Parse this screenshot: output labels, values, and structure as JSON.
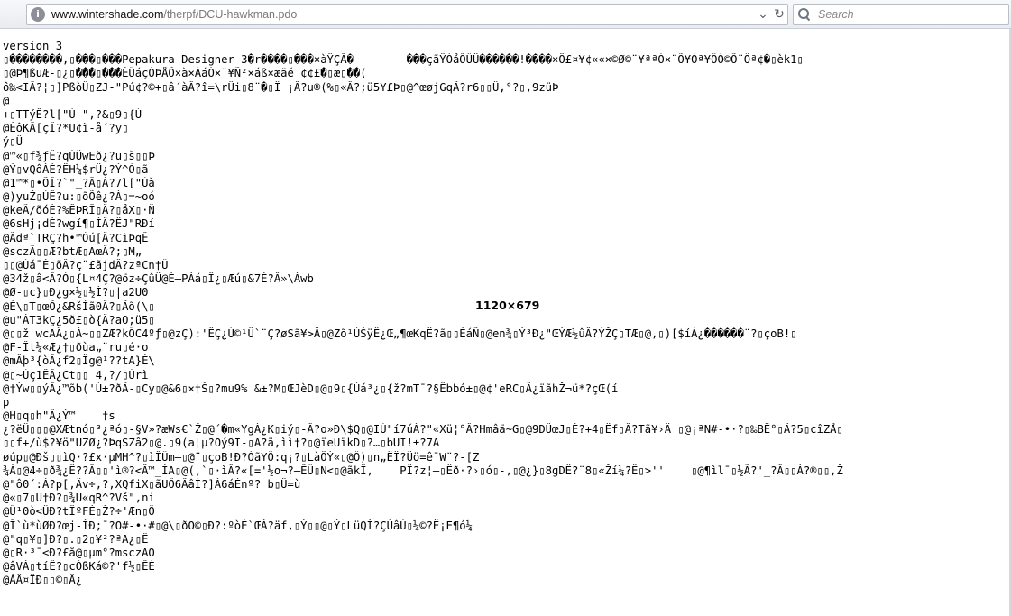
{
  "browser": {
    "url_host": "www.wintershade.com",
    "url_path": "/therpf/DCU-hawkman.pdo",
    "search_placeholder": "Search",
    "icons": {
      "site": "globe-icon",
      "dropdown": "chevron-down-icon",
      "reload": "reload-icon",
      "search": "search-icon"
    }
  },
  "overlay": {
    "dimension_label": "1120×679"
  },
  "document": {
    "lines": [
      "version 3",
      "▯��������,▯���▯���Pepakura Designer 3�r����▯���×àŸÇÂ�        ���çãŸÓåÕÛÜ������!����×Ö£¤¥¢««×©Ø©¨¥ªªÓ×¨Õ¥Óª¥ÔÓ©Õ¨Ôª¢�▯èk1▯",
      "▯@Þ¶ßuÆ-▯¿▯���▯���ÈÛáçÓÞÅÕ×à×ÀáÓ×¨¥Ñ²×áß×æäé ¢¢£�▯æ▯��(",
      "ô‰<IÂ?¦▯]PßòÜ▯ZJ-\"Pú¢?©+▯â´àÂ?î=\\rÜi▯8¨�▯Ï ¡Â?u®(%▯«Â?;ü5Y£Þ▯@^œøjGqÂ?r6▯▯Ü,°?▯,9züÞ",
      "@",
      "+▯TTýÊ?l[\"Ù \",?&▯9▯{Ú",
      "@ÈôKÂ[çÏ?*U¢ì-å´?y▯",
      "ý▯Ü",
      "@™«▯f¾ƒË?qÚÜwEð¿?u▯š▯▯Þ",
      "@Ý▯vQôÀÉ?ËH¼$rÜ¿?Ý^Ò▯ã",
      "@1™*▯•ÕÎ?`\"_?Â▯Á?7l[\"Ùà",
      "@)yuŽ▯ÙÊ?u:▯õÕê¿?Á▯=~oó",
      "@keÃ/õóÈ?%ÊÞRÎ▯Â?▯åX▯·Ñ",
      "@6sHj¡dÈ?wgí¶▯ÍÂ?ËJ\"RÐí",
      "@Ãdª`TRÇ?h•™Òú[Â?CìÞqÊ",
      "@sczÂ▯▯Æ?btÆ▯AœÂ?;▯M„",
      "▯▯@Úá¯É▯õÂ?ç¨£ãjdÂ?zªCn†Û",
      "@34ž▯â<Â?Ò▯{L¤4Ç?@öz÷ÇûÜ@È—PÁá▯Ï¿▯Æú▯&7È?Â»\\Àwb",
      "@Ø-▯c}▯Ð¿g×½▯½Ì?▯|a2U0",
      "@È\\▯T▯œÕ¿&RšÍã0Â?▯Âõ(\\▯",
      "@u\"ÁT3kÇ¿5ð£▯ò{Â?aO;ü5▯",
      "@▯▯ž wcAÂ¿▯À~▯▯ZÆ?kÔC4ºƒ▯@zÇ):'ËÇ¿Ú©¹Ü`¨Ç?øSã¥>Â▯@Zõ¹ÙŠÿË¿Œ„¶œKqË?ã▯▯ÉáÑ▯@en¾▯Ý³Ð¿\"ŒÝÆ½ûÂ?ÝŽÇ▯TÆ▯@,▯)[$íÀ¿������¨?▯çoB!▯",
      "@F-Ît¼«Æ¿†▯ðùa„¨ru▯é·o",
      "@mÂþ³{òÂ¿f2▯Ïg@¹??tA}È\\",
      "@▯~Ùç1ÊÂ¿Ct▯▯ 4,?/▯Úrì",
      "@‡Ýw▯▯ýÂ¿™õb('Ú±?ðÂ-▯Cy▯@&6▯×†Š▯?mu9% &±?M▯ŒJèD▯@▯9▯{Úá³¿▯{ž?mT¯?§Ëbbó±▯@¢'eRC▯Â¿ïãhŽ¬ü*?çŒ(í",
      "p",
      "@H▯q▯h\"Ä¿Ý™    †s",
      "¿?ëÜ▯▯▯@XÆtnó▯³¿ªó▯-§V»?æWs€`Ž▯@´�m«YgÀ¿K▯iý▯-Â?o»Ð\\$Q▯@IÙ\"í7úÀ?\"«Xü¦°Â?Hmâä~G▯@9DÜœJ▯È?+4▯Ëf▯Â?Tã¥›Ä ▯@¡ªN#-•·?▯‰BË°▯Â?5▯cîZÅ▯",
      "▯▯f+/ù$?¥ö\"ÚŽØ¿?ÞqŠŽâ2▯@.▯9(a¦µ?Öý9Ì-▯À?ä,ìì†?▯@ïeÚïkD▯?…▯bÙÌ!±?7Â",
      "øúp▯@Ðš▯▯ìQ·?£x·µMH^?▯ìÎÛm—▯@¨▯çoB!Ð?ÒãYÕ:q¡?▯LàÖÝ«▯@Ô)▯n„ËÏ?Üö=ê¯W¨?-[Z",
      "¾À▯@4÷▯ð¾¿Ë??Â▯▯'ì®?<Â™_ÍA▯@(,`▯·ìÂ?«[='½o¬?—ÊÛ▯N<▯@ãkÏ,    PÏ?z¦—▯Ëð·?›▯ó▯-‚▯@¿}▯8gDË?¨8▯«Ží¼?Ë▯>''    ▯@¶ìl¯▯½Ã?'_?Â▯▯Á?®▯▯,Ž",
      "@\"ô0´:Á?p[,Äv÷,?,XQfiX▯ãUÖ6ÂâÌ?]Á6áÉnº? b▯Ü=ù",
      "@«▯7▯U†Ð?▯¾Ü«qR^?Vš\",ni",
      "@Ü¹0ò<ÜÐ?tÏºFÉ▯Ž?÷'Æn▯Õ",
      "@Î`ù*ùØÐ?œj-ÌÐ;¯?O#-•·#▯@\\▯ðO©▯Ð?:ºòÈ`ŒÀ?äf,▯Ý▯▯@▯Ý▯LüQÌ?ÇÚâÙ▯¼©?Ë¡E¶ó¼",
      "@\"q▯¥▯]Ð?▯.▯2▯¥²?ªA¿▯Ë",
      "@▯R·³¯<Ð?£å@▯µm°?msczÂÕ",
      "@âVÁ▯tíË?▯cÒßKá©?'f½▯ÊÉ",
      "@ÁÄ¤ÏÐ▯▯©▯Ä¿"
    ]
  }
}
